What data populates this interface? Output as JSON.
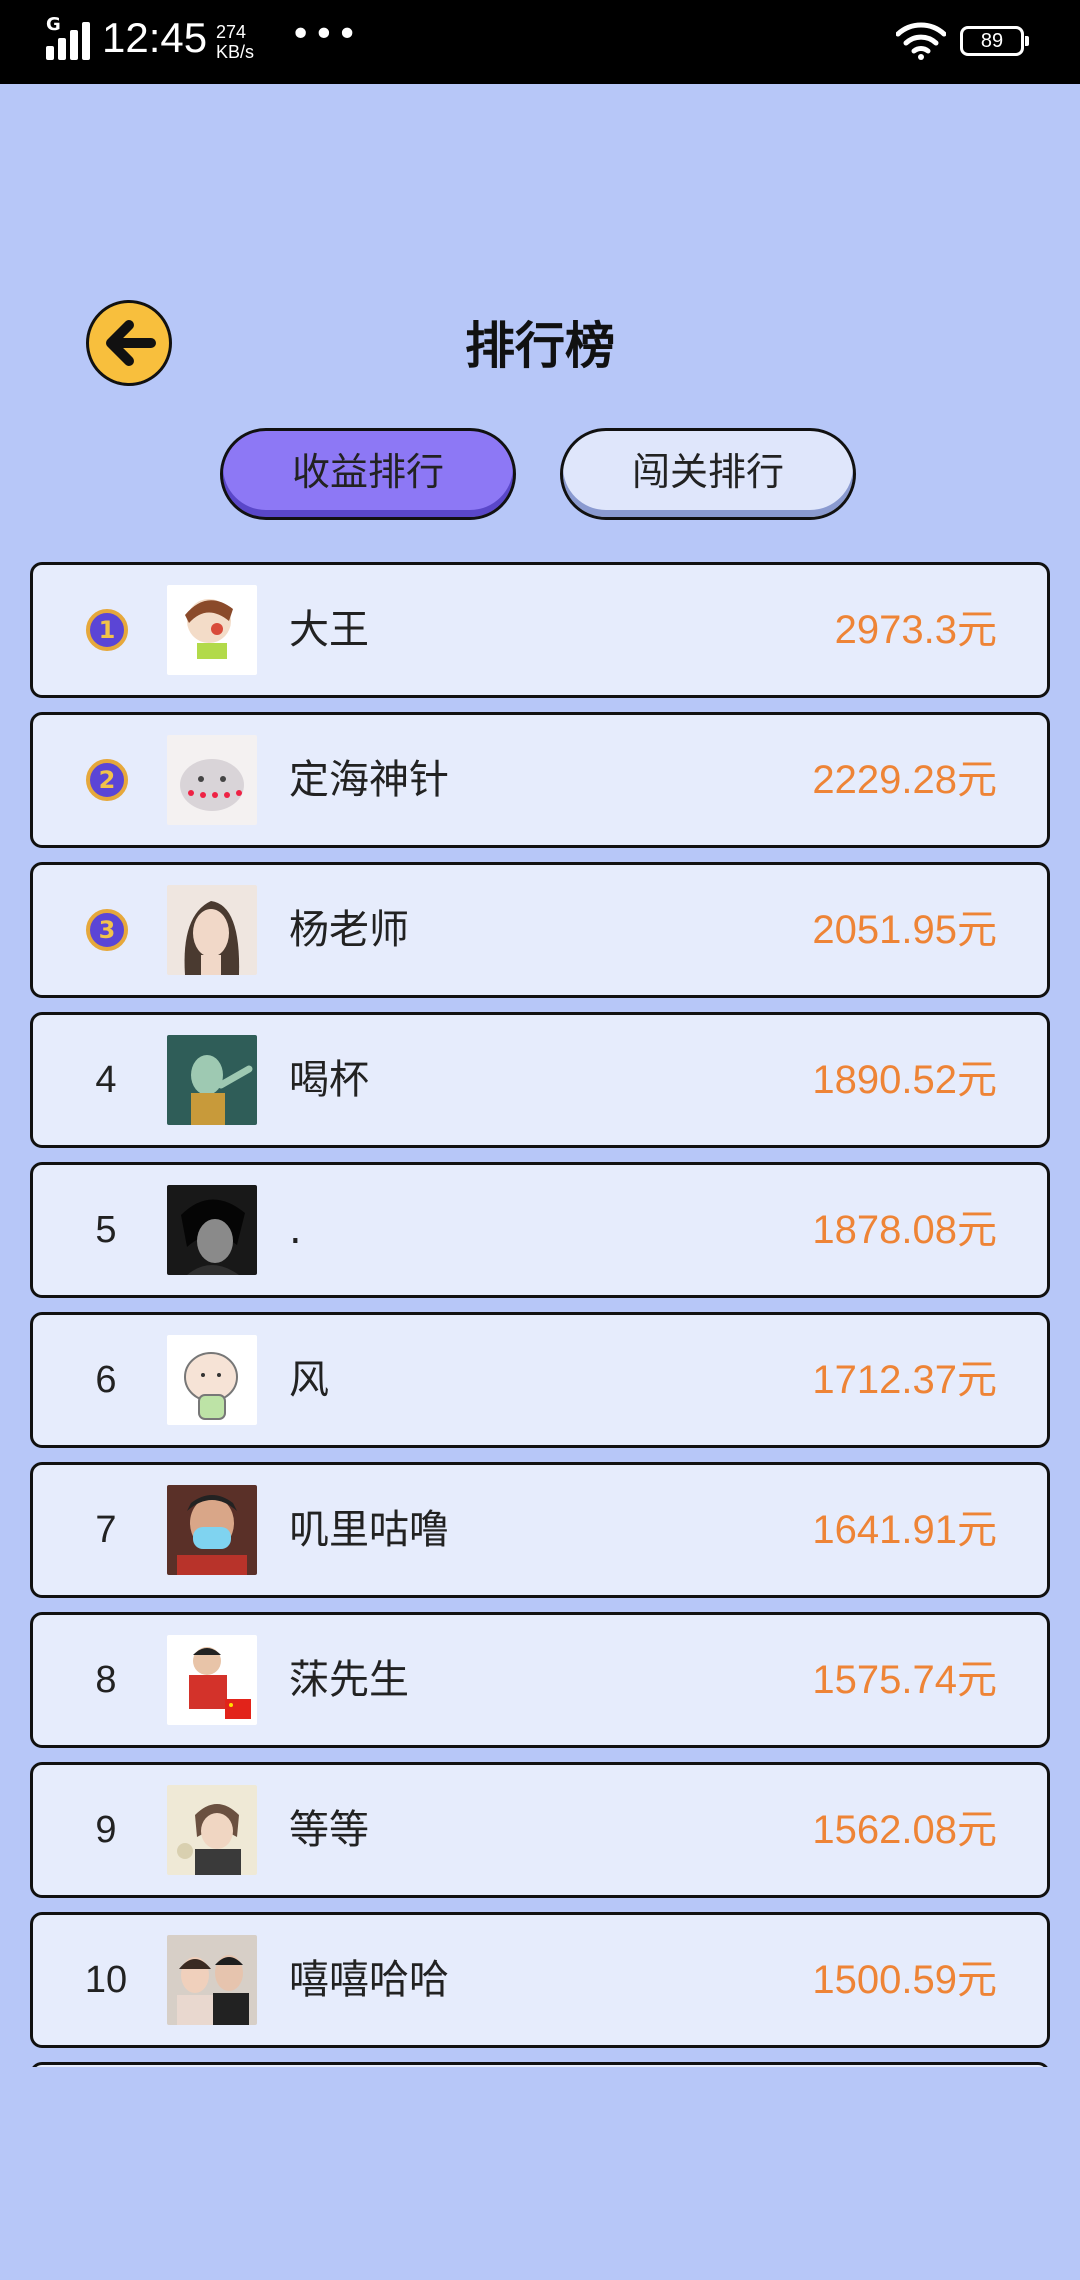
{
  "status_bar": {
    "network": "G",
    "time": "12:45",
    "speed_value": "274",
    "speed_unit": "KB/s",
    "more": "•••",
    "battery": "89"
  },
  "header": {
    "title": "排行榜",
    "back_icon": "arrow-left-icon"
  },
  "tabs": [
    {
      "label": "收益排行",
      "active": true
    },
    {
      "label": "闯关排行",
      "active": false
    }
  ],
  "colors": {
    "background": "#b7c7f8",
    "amount": "#ee8436",
    "active_tab": "#8d78f5",
    "back_button": "#f8bf3d"
  },
  "ranking": [
    {
      "rank": "1",
      "name": "大王",
      "amount": "2973.3元"
    },
    {
      "rank": "2",
      "name": "定海神针",
      "amount": "2229.28元"
    },
    {
      "rank": "3",
      "name": "杨老师",
      "amount": "2051.95元"
    },
    {
      "rank": "4",
      "name": "喝杯",
      "amount": "1890.52元"
    },
    {
      "rank": "5",
      "name": ".",
      "amount": "1878.08元"
    },
    {
      "rank": "6",
      "name": "风",
      "amount": "1712.37元"
    },
    {
      "rank": "7",
      "name": "叽里咕噜",
      "amount": "1641.91元"
    },
    {
      "rank": "8",
      "name": "莯先生",
      "amount": "1575.74元"
    },
    {
      "rank": "9",
      "name": "等等",
      "amount": "1562.08元"
    },
    {
      "rank": "10",
      "name": "嘻嘻哈哈",
      "amount": "1500.59元"
    },
    {
      "rank": "",
      "name": "",
      "amount": ""
    }
  ]
}
